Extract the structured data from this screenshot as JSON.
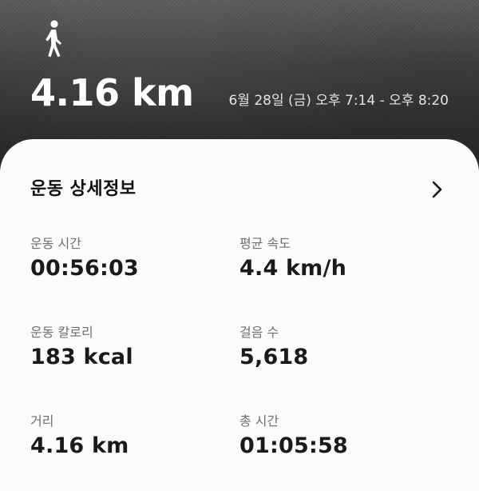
{
  "activity": {
    "icon": "walking-person-icon",
    "distance": "4.16 km",
    "date_range": "6월 28일 (금) 오후 7:14 - 오후 8:20"
  },
  "details": {
    "title": "운동 상세정보",
    "chevron_icon": "chevron-right-icon",
    "stats": [
      {
        "label": "운동 시간",
        "value": "00:56:03"
      },
      {
        "label": "평균 속도",
        "value": "4.4 km/h"
      },
      {
        "label": "운동 칼로리",
        "value": "183 kcal"
      },
      {
        "label": "걸음 수",
        "value": "5,618"
      },
      {
        "label": "거리",
        "value": "4.16 km"
      },
      {
        "label": "총 시간",
        "value": "01:05:58"
      }
    ]
  },
  "colors": {
    "panel_background": "#fbfbfd",
    "primary_text": "#1a1a1a",
    "secondary_text": "#6f6f6f",
    "hero_text": "#ffffff"
  }
}
